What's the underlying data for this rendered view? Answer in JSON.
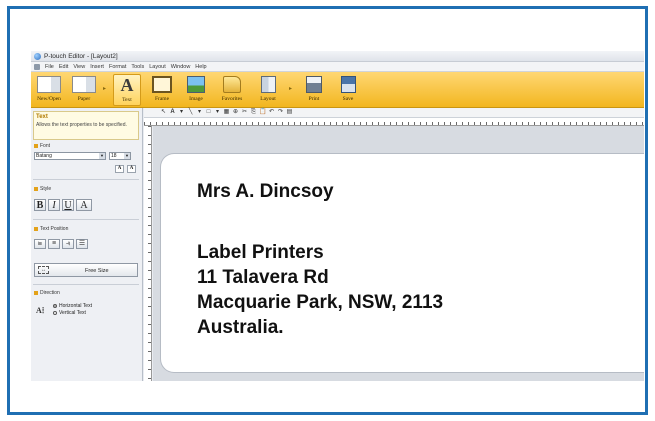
{
  "window": {
    "title": "P-touch Editor - [Layout2]"
  },
  "menu": [
    "File",
    "Edit",
    "View",
    "Insert",
    "Format",
    "Tools",
    "Layout",
    "Window",
    "Help"
  ],
  "ribbon": {
    "buttons": [
      {
        "label": "New/Open",
        "icon": "new-open-icon"
      },
      {
        "label": "Paper",
        "icon": "paper-icon"
      },
      {
        "label": "Text",
        "icon": "text-icon"
      },
      {
        "label": "Frame",
        "icon": "frame-icon"
      },
      {
        "label": "Image",
        "icon": "image-icon"
      },
      {
        "label": "Favorites",
        "icon": "favorites-icon"
      },
      {
        "label": "Layout",
        "icon": "layout-icon"
      },
      {
        "label": "Print",
        "icon": "print-icon"
      },
      {
        "label": "Save",
        "icon": "save-icon"
      }
    ],
    "active": "Text",
    "accent": "#f2b61f"
  },
  "panel": {
    "tooltip_title": "Text",
    "tooltip_text": "Allows the text properties to be specified.",
    "font_section": "Font",
    "font_name": "Batang",
    "font_size": "18",
    "grow_label": "A",
    "shrink_label": "A",
    "style_section": "Style",
    "style_buttons": [
      "B",
      "I",
      "U",
      "A"
    ],
    "position_section": "Text Position",
    "free_size_label": "Free Size",
    "direction_section": "Direction",
    "direction_icon": "A",
    "horizontal_text": "Horizontal Text",
    "vertical_text": "Vertical Text"
  },
  "label_text": {
    "name": "Mrs A. Dincsoy",
    "line1": "Label Printers",
    "line2": "11 Talavera Rd",
    "line3": "Macquarie Park, NSW, 2113",
    "line4": "Australia."
  }
}
